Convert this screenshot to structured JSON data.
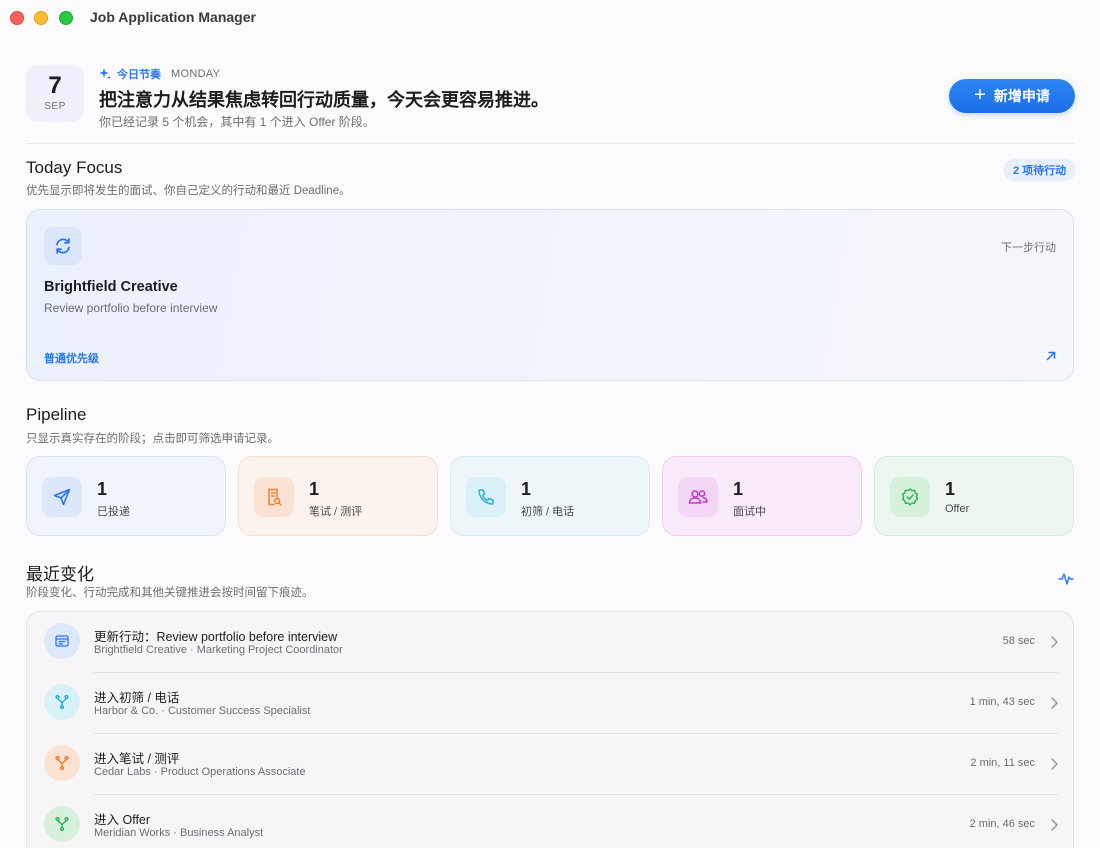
{
  "window": {
    "title": "Job Application Manager"
  },
  "header": {
    "date_day": "7",
    "date_month": "SEP",
    "eyebrow_label": "今日节奏",
    "eyebrow_day": "MONDAY",
    "headline": "把注意力从结果焦虑转回行动质量，今天会更容易推进。",
    "subline": "你已经记录 5 个机会，其中有 1 个进入 Offer 阶段。",
    "new_button": "新增申请",
    "accent": "#2a76f2"
  },
  "today_focus": {
    "title": "Today Focus",
    "subtitle": "优先显示即将发生的面试、你自己定义的行动和最近 Deadline。",
    "badge": "2 项待行动",
    "card": {
      "icon": "refresh-icon",
      "next_label": "下一步行动",
      "company": "Brightfield Creative",
      "task": "Review portfolio before interview",
      "priority": "普通优先级"
    }
  },
  "pipeline": {
    "title": "Pipeline",
    "subtitle": "只显示真实存在的阶段；点击即可筛选申请记录。",
    "stages": [
      {
        "count": "1",
        "label": "已投递",
        "icon": "paper-plane-icon",
        "color": "#2a76f2"
      },
      {
        "count": "1",
        "label": "笔试 / 测评",
        "icon": "document-search-icon",
        "color": "#f0812e"
      },
      {
        "count": "1",
        "label": "初筛 / 电话",
        "icon": "phone-icon",
        "color": "#27b3d1"
      },
      {
        "count": "1",
        "label": "面试中",
        "icon": "people-icon",
        "color": "#c239c8"
      },
      {
        "count": "1",
        "label": "Offer",
        "icon": "check-seal-icon",
        "color": "#2fb85a"
      }
    ]
  },
  "recent": {
    "title": "最近变化",
    "subtitle": "阶段变化、行动完成和其他关键推进会按时间留下痕迹。",
    "items": [
      {
        "title": "更新行动：Review portfolio before interview",
        "sub": "Brightfield Creative · Marketing Project Coordinator",
        "time": "58 sec",
        "icon": "note-icon",
        "color": "#2a76f2"
      },
      {
        "title": "进入初筛 / 电话",
        "sub": "Harbor & Co. · Customer Success Specialist",
        "time": "1 min, 43 sec",
        "icon": "branch-icon",
        "color": "#27b3d1"
      },
      {
        "title": "进入笔试 / 测评",
        "sub": "Cedar Labs · Product Operations Associate",
        "time": "2 min, 11 sec",
        "icon": "branch-icon",
        "color": "#f0812e"
      },
      {
        "title": "进入 Offer",
        "sub": "Meridian Works · Business Analyst",
        "time": "2 min, 46 sec",
        "icon": "branch-icon",
        "color": "#2fb85a"
      }
    ]
  }
}
